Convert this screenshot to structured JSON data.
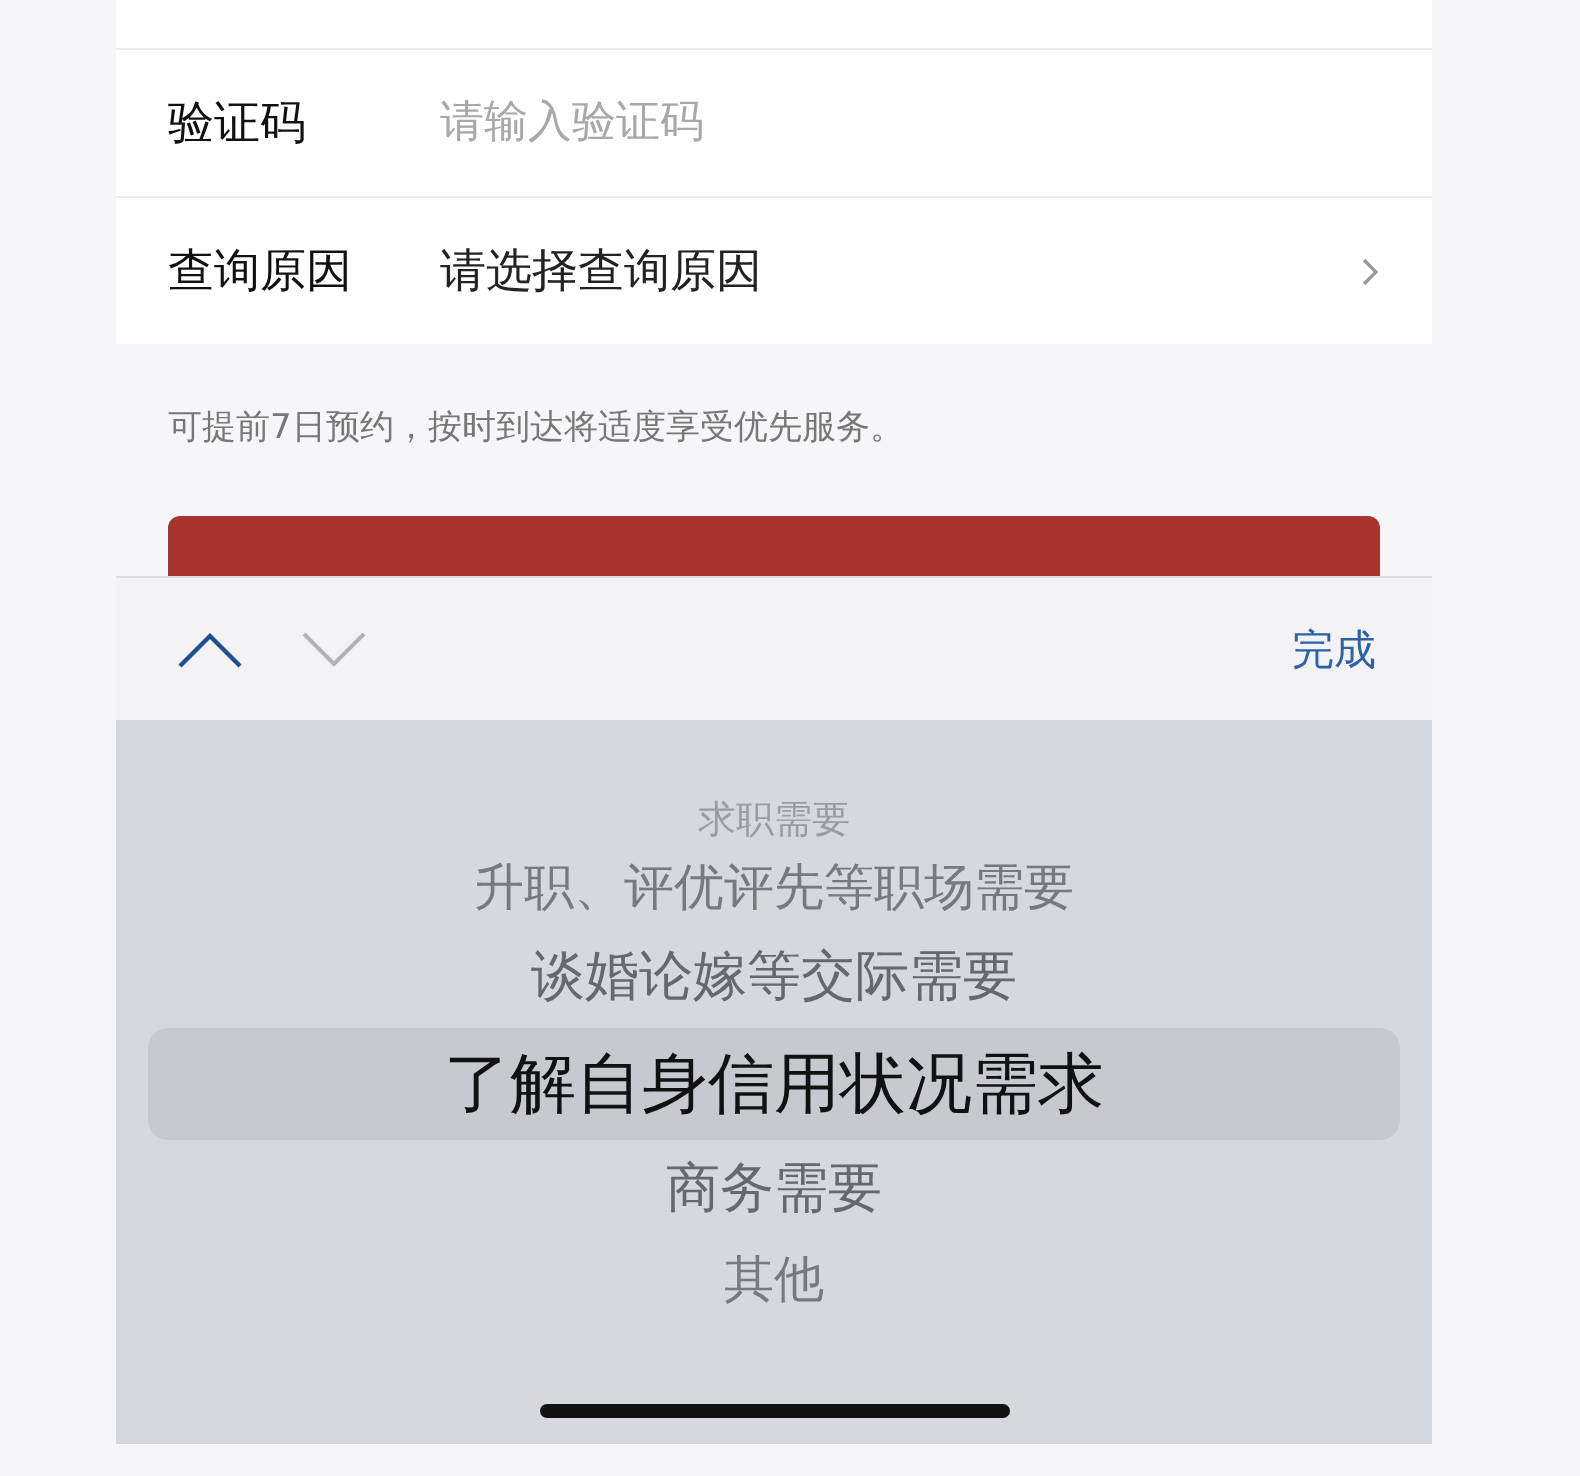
{
  "form": {
    "rows": [
      {
        "kind": "input",
        "label": "验证码",
        "placeholder": "请输入验证码"
      },
      {
        "kind": "select",
        "label": "查询原因",
        "value": "请选择查询原因"
      }
    ]
  },
  "note": "可提前7日预约，按时到达将适度享受优先服务。",
  "toolbar": {
    "done": "完成"
  },
  "picker": {
    "items": [
      {
        "label": "求职需要",
        "selected": false
      },
      {
        "label": "升职、评优评先等职场需要",
        "selected": false
      },
      {
        "label": "谈婚论嫁等交际需要",
        "selected": false
      },
      {
        "label": "了解自身信用状况需求",
        "selected": true
      },
      {
        "label": "商务需要",
        "selected": false
      },
      {
        "label": "其他",
        "selected": false
      }
    ]
  }
}
